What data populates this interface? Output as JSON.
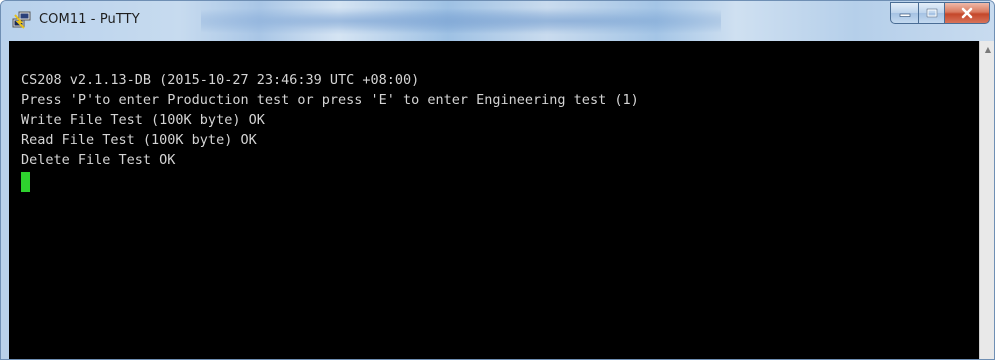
{
  "window": {
    "title": "COM11 - PuTTY",
    "app_icon": "putty-icon"
  },
  "controls": {
    "minimize_icon": "minimize-icon",
    "maximize_icon": "maximize-icon",
    "close_icon": "close-icon"
  },
  "terminal": {
    "lines": [
      "CS208 v2.1.13-DB (2015-10-27 23:46:39 UTC +08:00)",
      "Press 'P'to enter Production test or press 'E' to enter Engineering test (1)",
      "Write File Test (100K byte) OK",
      "Read File Test (100K byte) OK",
      "Delete File Test OK"
    ],
    "text_color": "#d4d4d4",
    "background_color": "#000000",
    "cursor_color": "#2ed12e"
  }
}
